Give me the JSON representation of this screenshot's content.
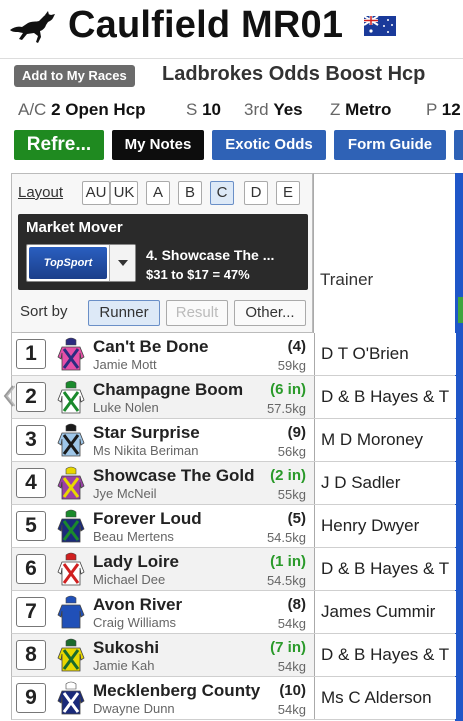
{
  "header": {
    "title": "Caulfield MR01",
    "logo_icon": "racehorse-icon",
    "flag_icon": "australia-flag-icon"
  },
  "race": {
    "add_button": "Add to My Races",
    "name": "Ladbrokes Odds Boost Hcp"
  },
  "race_info": [
    {
      "key": "A/C",
      "value": "2 Open Hcp"
    },
    {
      "key": "S",
      "value": "10"
    },
    {
      "key": "3rd",
      "value": "Yes"
    },
    {
      "key": "Z",
      "value": "Metro"
    },
    {
      "key": "P",
      "value": "12"
    }
  ],
  "toolbar": {
    "refresh": "Refre...",
    "notes": "My Notes",
    "exotic": "Exotic Odds",
    "form_guide": "Form Guide"
  },
  "layout": {
    "label": "Layout",
    "tabs": [
      "AU",
      "UK",
      "A",
      "B",
      "C",
      "D",
      "E"
    ],
    "active": "C"
  },
  "market_mover": {
    "title": "Market Mover",
    "bookie": "TopSport",
    "runner": "4. Showcase The ...",
    "odds_move": "$31 to $17 = 47%"
  },
  "sort": {
    "label": "Sort by",
    "options": [
      "Runner",
      "Result",
      "Other..."
    ],
    "active": "Runner",
    "disabled": "Result"
  },
  "columns": {
    "trainer": "Trainer"
  },
  "runners": [
    {
      "num": "1",
      "name": "Can't Be Done",
      "jockey": "Jamie Mott",
      "barrier": "(4)",
      "barrier_green": false,
      "weight": "59kg",
      "trainer": "D T O'Brien",
      "silk": [
        "#e64fa8",
        "#2c2c80"
      ]
    },
    {
      "num": "2",
      "name": "Champagne Boom",
      "jockey": "Luke Nolen",
      "barrier": "(6 in)",
      "barrier_green": true,
      "weight": "57.5kg",
      "trainer": "D & B Hayes & T",
      "silk": [
        "#ffffff",
        "#1a8a2c"
      ]
    },
    {
      "num": "3",
      "name": "Star Surprise",
      "jockey": "Ms Nikita Beriman",
      "barrier": "(9)",
      "barrier_green": false,
      "weight": "56kg",
      "trainer": "M D Moroney",
      "silk": [
        "#9ec6e8",
        "#1a1a1a"
      ]
    },
    {
      "num": "4",
      "name": "Showcase The Gold",
      "jockey": "Jye McNeil",
      "barrier": "(2 in)",
      "barrier_green": true,
      "weight": "55kg",
      "trainer": "J D Sadler",
      "silk": [
        "#9a3fa8",
        "#e8d800"
      ]
    },
    {
      "num": "5",
      "name": "Forever Loud",
      "jockey": "Beau Mertens",
      "barrier": "(5)",
      "barrier_green": false,
      "weight": "54.5kg",
      "trainer": "Henry Dwyer",
      "silk": [
        "#1a2a7a",
        "#1a8a2c"
      ]
    },
    {
      "num": "6",
      "name": "Lady Loire",
      "jockey": "Michael Dee",
      "barrier": "(1 in)",
      "barrier_green": true,
      "weight": "54.5kg",
      "trainer": "D & B Hayes & T",
      "silk": [
        "#ffffff",
        "#d02020"
      ]
    },
    {
      "num": "7",
      "name": "Avon River",
      "jockey": "Craig Williams",
      "barrier": "(8)",
      "barrier_green": false,
      "weight": "54kg",
      "trainer": "James Cummir",
      "silk": [
        "#2050b8",
        "#2050b8"
      ]
    },
    {
      "num": "8",
      "name": "Sukoshi",
      "jockey": "Jamie Kah",
      "barrier": "(7 in)",
      "barrier_green": true,
      "weight": "54kg",
      "trainer": "D & B Hayes & T",
      "silk": [
        "#e8d800",
        "#1a6a2c"
      ]
    },
    {
      "num": "9",
      "name": "Mecklenberg County",
      "jockey": "Dwayne Dunn",
      "barrier": "(10)",
      "barrier_green": false,
      "weight": "54kg",
      "trainer": "Ms C Alderson",
      "silk": [
        "#1a2a7a",
        "#ffffff"
      ]
    }
  ],
  "colors": {
    "refresh": "#1f8a20",
    "notes": "#0d0d0d",
    "toolbar_blue": "#2f62b6",
    "green_barrier": "#2a9a2a"
  }
}
